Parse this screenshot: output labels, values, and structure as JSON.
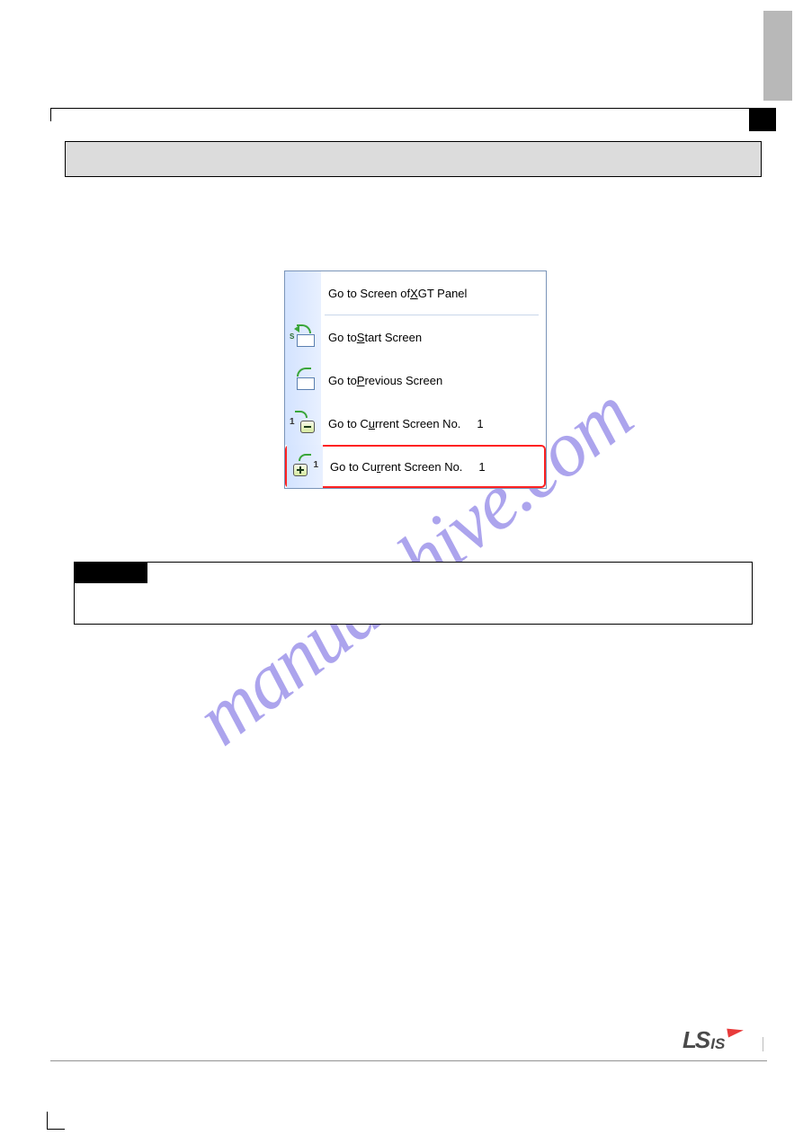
{
  "watermark": "manualshive.com",
  "menu": {
    "items": [
      {
        "label_pre": "Go to Screen of ",
        "hotkey": "X",
        "label_post": "GT Panel",
        "num": ""
      },
      {
        "label_pre": "Go to ",
        "hotkey": "S",
        "label_post": "tart Screen",
        "num": ""
      },
      {
        "label_pre": "Go to ",
        "hotkey": "P",
        "label_post": "revious Screen",
        "num": ""
      },
      {
        "label_pre": "Go to C",
        "hotkey": "u",
        "label_post": "rrent Screen No.",
        "num": "1"
      },
      {
        "label_pre": "Go to Cu",
        "hotkey": "r",
        "label_post": "rent Screen No.",
        "num": "1"
      }
    ]
  },
  "logo": {
    "ls": "LS",
    "is": "IS"
  }
}
